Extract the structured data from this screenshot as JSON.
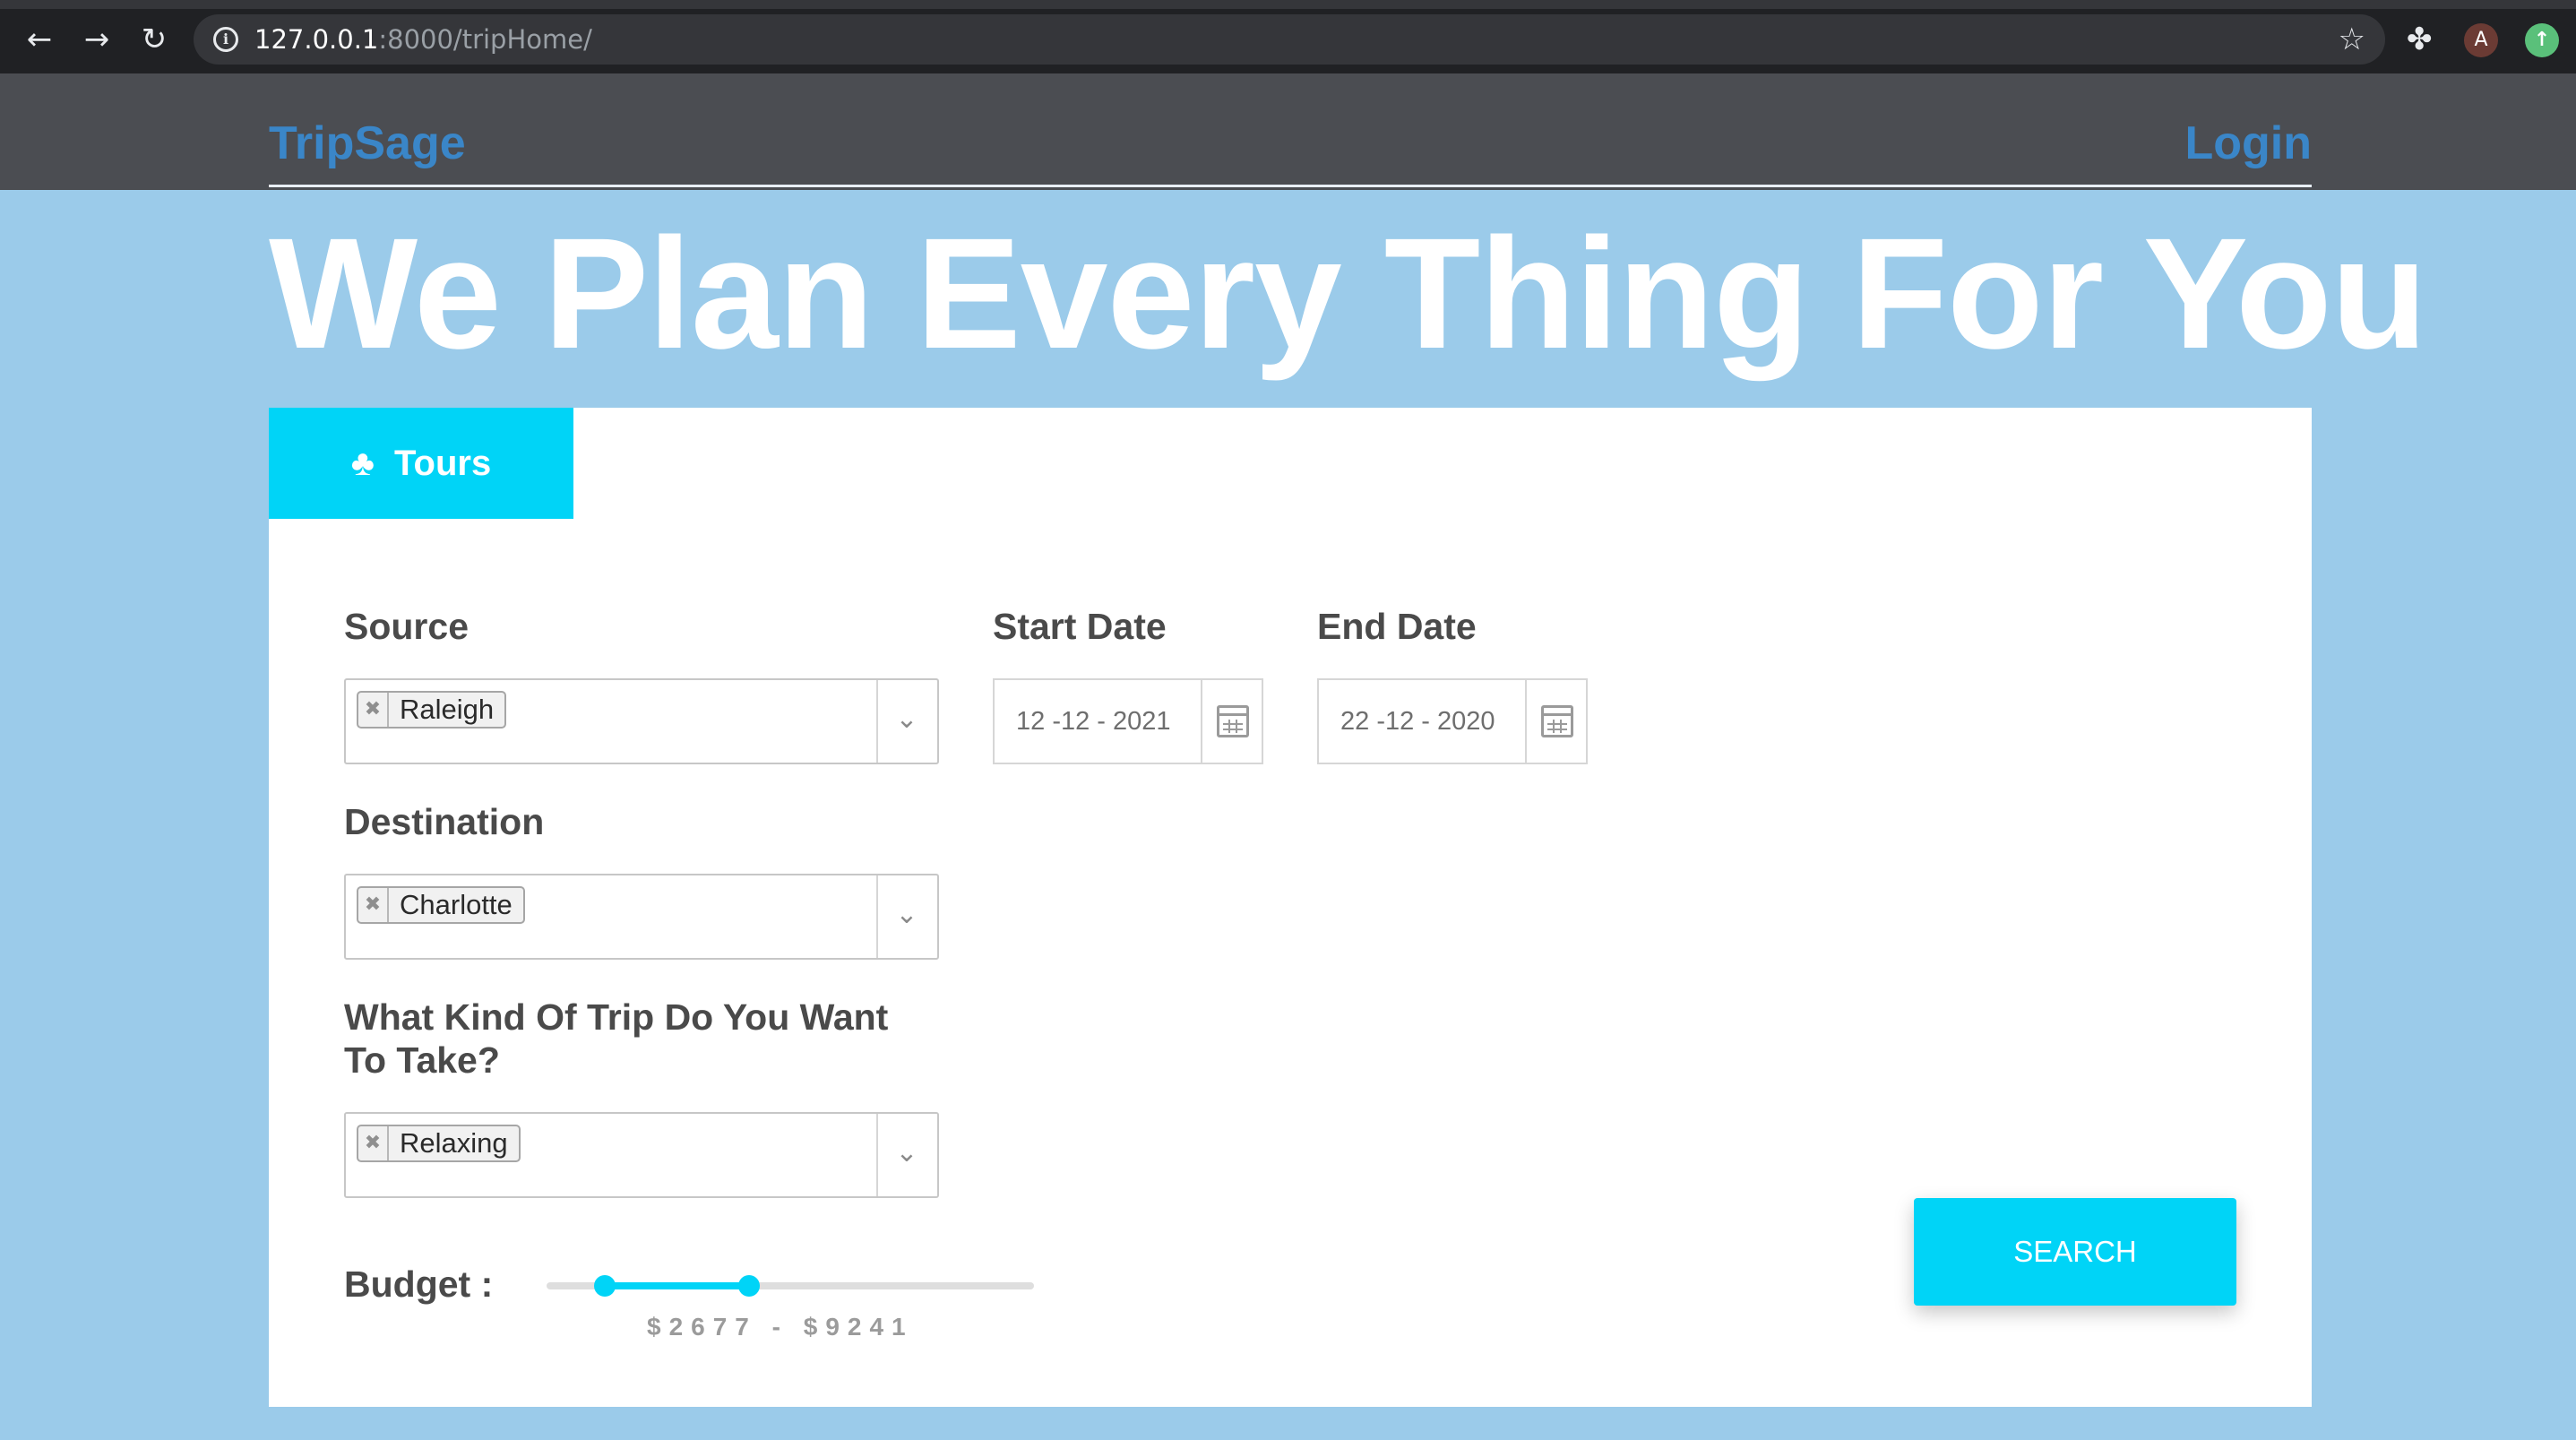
{
  "browser": {
    "url_host": "127.0.0.1",
    "url_rest": ":8000/tripHome/",
    "profile_initial": "A",
    "icons": {
      "back": "back-arrow-icon",
      "forward": "forward-arrow-icon",
      "reload": "reload-icon",
      "site_info": "info-icon",
      "bookmark": "star-icon",
      "extensions": "puzzle-icon",
      "update": "update-arrow-icon"
    }
  },
  "header": {
    "brand": "TripSage",
    "login": "Login"
  },
  "hero": {
    "title": "We Plan Every Thing For You"
  },
  "tabs": [
    {
      "label": "Tours",
      "icon": "tree-icon",
      "active": true
    }
  ],
  "form": {
    "source": {
      "label": "Source",
      "selected": "Raleigh"
    },
    "destination": {
      "label": "Destination",
      "selected": "Charlotte"
    },
    "trip_type": {
      "label_line1": "What Kind Of Trip Do You Want",
      "label_line2": "To Take?",
      "selected": "Relaxing"
    },
    "start_date": {
      "label": "Start Date",
      "value": "12 -12 - 2021"
    },
    "end_date": {
      "label": "End Date",
      "value": "22 -12 - 2020"
    },
    "budget": {
      "label": "Budget :",
      "range_text": "$2677 - $9241",
      "min_value": 2677,
      "max_value": 9241,
      "min_fraction": 0.12,
      "max_fraction": 0.415
    },
    "search_label": "SEARCH"
  },
  "colors": {
    "accent": "#00d4f7",
    "brand": "#3a86c8",
    "page_bg": "#9bcbea",
    "header_bg": "#4b4d52"
  }
}
